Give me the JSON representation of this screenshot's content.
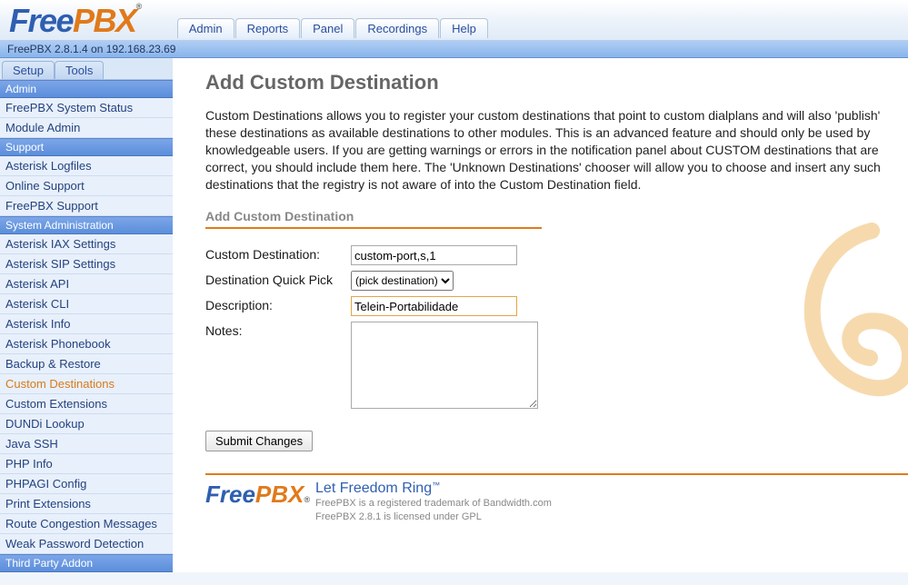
{
  "header": {
    "topnav": [
      "Admin",
      "Reports",
      "Panel",
      "Recordings",
      "Help"
    ],
    "version_bar": "FreePBX 2.8.1.4 on 192.168.23.69"
  },
  "sidebar": {
    "tabs": [
      "Setup",
      "Tools"
    ],
    "sections": [
      {
        "title": "Admin",
        "items": [
          "FreePBX System Status",
          "Module Admin"
        ]
      },
      {
        "title": "Support",
        "items": [
          "Asterisk Logfiles",
          "Online Support",
          "FreePBX Support"
        ]
      },
      {
        "title": "System Administration",
        "items": [
          "Asterisk IAX Settings",
          "Asterisk SIP Settings",
          "Asterisk API",
          "Asterisk CLI",
          "Asterisk Info",
          "Asterisk Phonebook",
          "Backup & Restore",
          "Custom Destinations",
          "Custom Extensions",
          "DUNDi Lookup",
          "Java SSH",
          "PHP Info",
          "PHPAGI Config",
          "Print Extensions",
          "Route Congestion Messages",
          "Weak Password Detection"
        ]
      },
      {
        "title": "Third Party Addon",
        "items": []
      }
    ],
    "active_item": "Custom Destinations"
  },
  "main": {
    "title": "Add Custom Destination",
    "intro": "Custom Destinations allows you to register your custom destinations that point to custom dialplans and will also 'publish' these destinations as available destinations to other modules. This is an advanced feature and should only be used by knowledgeable users. If you are getting warnings or errors in the notification panel about CUSTOM destinations that are correct, you should include them here. The 'Unknown Destinations' chooser will allow you to choose and insert any such destinations that the registry is not aware of into the Custom Destination field.",
    "section_title": "Add Custom Destination",
    "fields": {
      "custom_destination_label": "Custom Destination:",
      "custom_destination_value": "custom-port,s,1",
      "quickpick_label": "Destination Quick Pick",
      "quickpick_selected": "(pick destination)",
      "description_label": "Description:",
      "description_value": "Telein-Portabilidade",
      "notes_label": "Notes:",
      "notes_value": ""
    },
    "submit_label": "Submit Changes"
  },
  "footer": {
    "slogan": "Let Freedom Ring",
    "copy1": "FreePBX is a registered trademark of Bandwidth.com",
    "copy2": "FreePBX 2.8.1 is licensed under GPL"
  }
}
